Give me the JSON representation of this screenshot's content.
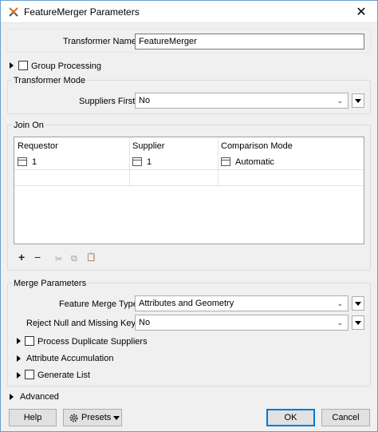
{
  "window": {
    "title": "FeatureMerger Parameters",
    "close_glyph": "✕"
  },
  "transformer_name": {
    "label": "Transformer Name:",
    "value": "FeatureMerger"
  },
  "group_processing": {
    "label": "Group Processing",
    "checked": false
  },
  "transformer_mode": {
    "title": "Transformer Mode",
    "suppliers_first": {
      "label": "Suppliers First:",
      "value": "No"
    }
  },
  "join_on": {
    "title": "Join On",
    "columns": [
      "Requestor",
      "Supplier",
      "Comparison Mode"
    ],
    "rows": [
      {
        "requestor": "1",
        "supplier": "1",
        "comparison_mode": "Automatic"
      }
    ],
    "toolbar": {
      "add": "+",
      "remove": "−",
      "cut": "✂",
      "copy": "⧉",
      "paste": "📋"
    }
  },
  "merge_parameters": {
    "title": "Merge Parameters",
    "feature_merge_type": {
      "label": "Feature Merge Type:",
      "value": "Attributes and Geometry"
    },
    "reject_null": {
      "label": "Reject Null and Missing Keys:",
      "value": "No"
    },
    "process_duplicate": {
      "label": "Process Duplicate Suppliers",
      "checked": false
    },
    "attribute_accumulation": {
      "label": "Attribute Accumulation"
    },
    "generate_list": {
      "label": "Generate List",
      "checked": false
    }
  },
  "advanced": {
    "label": "Advanced"
  },
  "buttons": {
    "help": "Help",
    "presets": "Presets",
    "ok": "OK",
    "cancel": "Cancel"
  },
  "colors": {
    "accent": "#0078d7",
    "window_border": "#6d9ecb"
  }
}
